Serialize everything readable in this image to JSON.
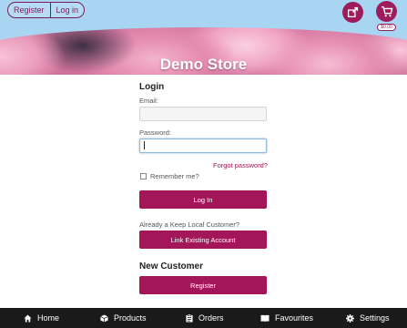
{
  "header": {
    "auth": {
      "register_label": "Register",
      "login_label": "Log in"
    },
    "store_title": "Demo Store",
    "cart_badge": "$0.00",
    "colors": {
      "sky": "#a8d6f2",
      "accent": "#9e1b5c"
    }
  },
  "login": {
    "heading": "Login",
    "email_label": "Email:",
    "email_value": "",
    "password_label": "Password:",
    "password_value": "",
    "forgot_label": "Forgot password?",
    "remember_label": "Remember me?",
    "login_button": "Log In",
    "link_prompt": "Already a Keep Local Customer?",
    "link_button": "Link Existing Account"
  },
  "new_customer": {
    "heading": "New Customer",
    "register_button": "Register"
  },
  "bottom_nav": {
    "items": [
      {
        "label": "Home",
        "icon": "home-icon"
      },
      {
        "label": "Products",
        "icon": "box-icon"
      },
      {
        "label": "Orders",
        "icon": "clipboard-icon"
      },
      {
        "label": "Favourites",
        "icon": "book-icon"
      },
      {
        "label": "Settings",
        "icon": "gear-icon"
      }
    ]
  }
}
